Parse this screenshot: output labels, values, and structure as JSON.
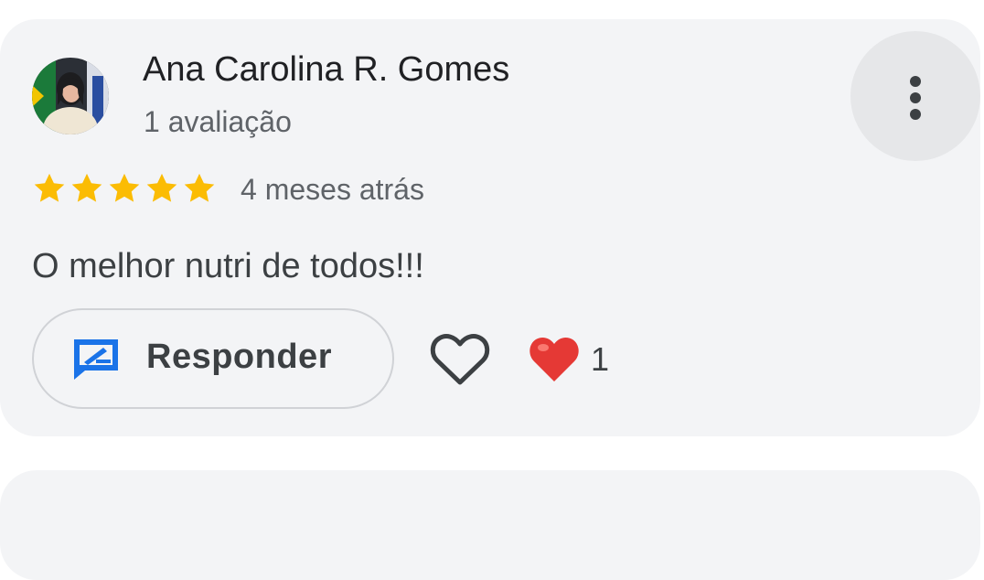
{
  "review": {
    "author_name": "Ana Carolina R. Gomes",
    "author_meta": "1 avaliação",
    "rating": 5,
    "rating_max": 5,
    "time_ago": "4 meses atrás",
    "text": "O melhor nutri de todos!!!",
    "reply_label": "Responder",
    "reaction_count": "1"
  },
  "icons": {
    "more": "more-vertical-icon",
    "star": "star-icon",
    "reply": "reply-icon",
    "like": "heart-outline-icon",
    "reaction": "heart-filled-icon"
  },
  "colors": {
    "star": "#fbbc04",
    "reply_icon": "#1a73e8",
    "heart": "#e53935",
    "card_bg": "#f3f4f6"
  }
}
